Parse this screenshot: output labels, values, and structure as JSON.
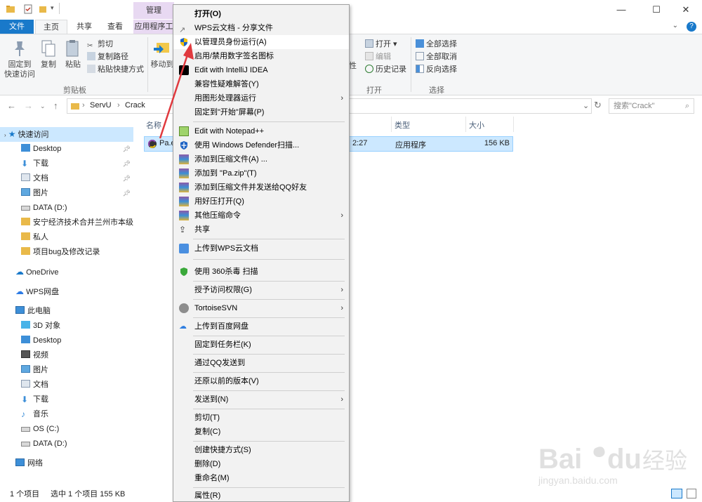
{
  "titlebar": {
    "manage_label": "管理",
    "minimize": "—",
    "maximize": "☐",
    "close": "✕"
  },
  "tabs": {
    "file": "文件",
    "home": "主页",
    "share": "共享",
    "view": "查看",
    "app": "应用程序工"
  },
  "ribbon": {
    "pin": "固定到\n快速访问",
    "pin_line1": "固定到",
    "pin_line2": "快速访问",
    "copy": "复制",
    "paste": "粘贴",
    "cut": "剪切",
    "copy_path": "复制路径",
    "paste_shortcut": "粘贴快捷方式",
    "move_to": "移动到",
    "clipboard_group": "剪贴板",
    "open": "打开",
    "edit": "编辑",
    "history": "历史记录",
    "open_group": "打开",
    "select_all": "全部选择",
    "select_none": "全部取消",
    "invert_select": "反向选择",
    "select_group": "选择",
    "property_partial": "性"
  },
  "address": {
    "seg1": "ServU",
    "seg2": "Crack",
    "search_placeholder": "搜索\"Crack\""
  },
  "sidebar": {
    "quick_access": "快速访问",
    "items": [
      {
        "label": "Desktop"
      },
      {
        "label": "下载"
      },
      {
        "label": "文档"
      },
      {
        "label": "图片"
      },
      {
        "label": "DATA (D:)"
      },
      {
        "label": "安宁经济技术合并兰州市本级平"
      },
      {
        "label": "私人"
      },
      {
        "label": "项目bug及修改记录"
      }
    ],
    "onedrive": "OneDrive",
    "wps": "WPS网盘",
    "this_pc": "此电脑",
    "pc_items": [
      {
        "label": "3D 对象"
      },
      {
        "label": "Desktop"
      },
      {
        "label": "视频"
      },
      {
        "label": "图片"
      },
      {
        "label": "文档"
      },
      {
        "label": "下载"
      },
      {
        "label": "音乐"
      },
      {
        "label": "OS (C:)"
      },
      {
        "label": "DATA (D:)"
      }
    ],
    "network": "网络"
  },
  "filelist": {
    "col_name": "名称",
    "col_type": "类型",
    "col_size": "大小",
    "file_name": "Pa.e",
    "file_time": "2:27",
    "file_type": "应用程序",
    "file_size": "156 KB"
  },
  "statusbar": {
    "count": "1 个项目",
    "selected": "选中 1 个项目  155 KB"
  },
  "context_menu": {
    "open": "打开(O)",
    "wps_share": "WPS云文档 - 分享文件",
    "run_admin": "以管理员身份运行(A)",
    "sign": "启用/禁用数字签名图标",
    "intellij": "Edit with IntelliJ IDEA",
    "compat": "兼容性疑难解答(Y)",
    "gpu": "用图形处理器运行",
    "pin_start": "固定到\"开始\"屏幕(P)",
    "notepad": "Edit with Notepad++",
    "defender": "使用 Windows Defender扫描...",
    "add_archive": "添加到压缩文件(A) ...",
    "add_zip": "添加到 \"Pa.zip\"(T)",
    "add_qq": "添加到压缩文件并发送给QQ好友",
    "haozip": "用好压打开(Q)",
    "other_zip": "其他压缩命令",
    "share": "共享",
    "upload_wps": "上传到WPS云文档",
    "scan360": "使用 360杀毒 扫描",
    "grant": "授予访问权限(G)",
    "svn": "TortoiseSVN",
    "baidu": "上传到百度网盘",
    "pin_taskbar": "固定到任务栏(K)",
    "qq_send": "通过QQ发送到",
    "restore": "还原以前的版本(V)",
    "send_to": "发送到(N)",
    "cut": "剪切(T)",
    "copy": "复制(C)",
    "shortcut": "创建快捷方式(S)",
    "delete": "删除(D)",
    "rename": "重命名(M)",
    "properties": "属性(R)"
  },
  "watermark": {
    "brand": "Bai",
    "brand2": "du",
    "cn": "经验",
    "url": "jingyan.baidu.com"
  },
  "colors": {
    "accent": "#1979ca",
    "selection": "#cce8ff",
    "manage_tab": "#e8d9f2",
    "annotation": "#e0393e"
  }
}
